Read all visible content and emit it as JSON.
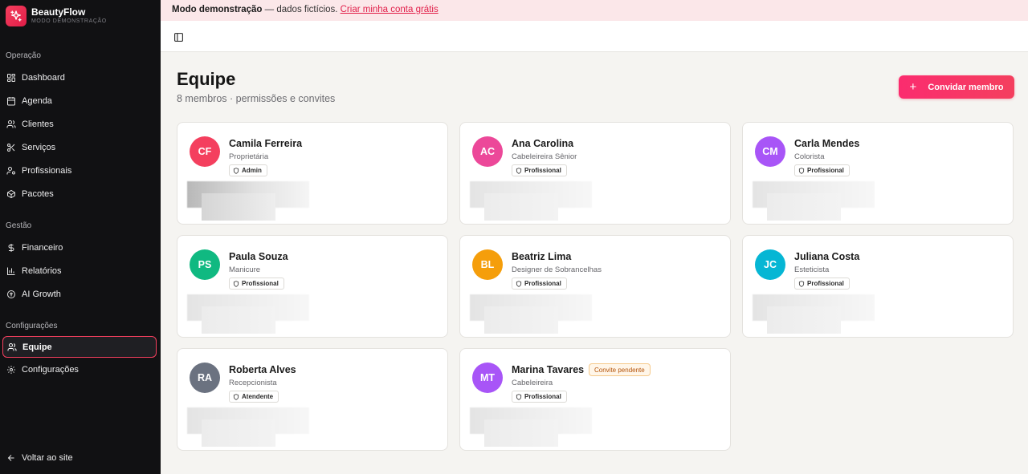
{
  "brand": {
    "name": "BeautyFlow",
    "subtitle": "MODO DEMONSTRAÇÃO"
  },
  "sidebar": {
    "sections": [
      {
        "title": "Operação",
        "items": [
          {
            "label": "Dashboard",
            "icon": "dashboard-icon"
          },
          {
            "label": "Agenda",
            "icon": "calendar-icon"
          },
          {
            "label": "Clientes",
            "icon": "users-icon"
          },
          {
            "label": "Serviços",
            "icon": "scissors-icon"
          },
          {
            "label": "Profissionais",
            "icon": "user-cog-icon"
          },
          {
            "label": "Pacotes",
            "icon": "package-icon"
          }
        ]
      },
      {
        "title": "Gestão",
        "items": [
          {
            "label": "Financeiro",
            "icon": "dollar-icon"
          },
          {
            "label": "Relatórios",
            "icon": "bar-chart-icon"
          },
          {
            "label": "AI Growth",
            "icon": "brain-icon"
          }
        ]
      },
      {
        "title": "Configurações",
        "items": [
          {
            "label": "Equipe",
            "icon": "team-icon",
            "active": true
          },
          {
            "label": "Configurações",
            "icon": "gear-icon"
          }
        ]
      }
    ],
    "back_label": "Voltar ao site"
  },
  "banner": {
    "bold": "Modo demonstração",
    "text": " — dados fictícios. ",
    "link": "Criar minha conta grátis"
  },
  "page": {
    "title": "Equipe",
    "subtitle": "8 membros · permissões e convites",
    "invite_label": "Convidar membro"
  },
  "members": [
    {
      "initials": "CF",
      "name": "Camila Ferreira",
      "role": "Proprietária",
      "permission": "Admin",
      "color": "#f43f5e"
    },
    {
      "initials": "AC",
      "name": "Ana Carolina",
      "role": "Cabeleireira Sênior",
      "permission": "Profissional",
      "color": "#ec4899"
    },
    {
      "initials": "CM",
      "name": "Carla Mendes",
      "role": "Colorista",
      "permission": "Profissional",
      "color": "#a855f7"
    },
    {
      "initials": "PS",
      "name": "Paula Souza",
      "role": "Manicure",
      "permission": "Profissional",
      "color": "#10b981"
    },
    {
      "initials": "BL",
      "name": "Beatriz Lima",
      "role": "Designer de Sobrancelhas",
      "permission": "Profissional",
      "color": "#f59e0b"
    },
    {
      "initials": "JC",
      "name": "Juliana Costa",
      "role": "Esteticista",
      "permission": "Profissional",
      "color": "#06b6d4"
    },
    {
      "initials": "RA",
      "name": "Roberta Alves",
      "role": "Recepcionista",
      "permission": "Atendente",
      "color": "#6b7280"
    },
    {
      "initials": "MT",
      "name": "Marina Tavares",
      "role": "Cabeleireira",
      "permission": "Profissional",
      "color": "#a855f7",
      "pending": "Convite pendente"
    }
  ]
}
